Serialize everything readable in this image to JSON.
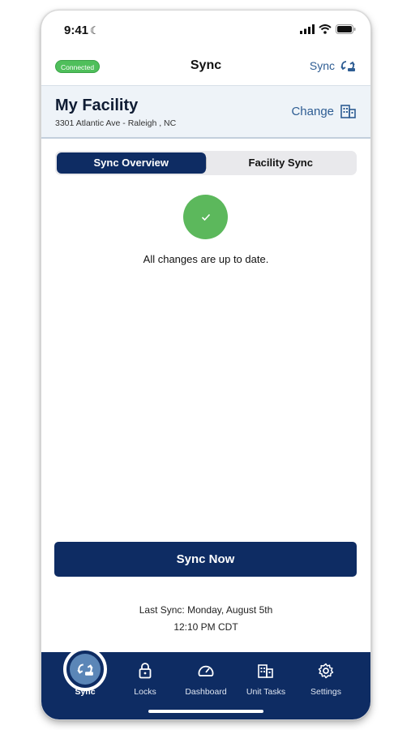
{
  "status_bar": {
    "time": "9:41"
  },
  "header": {
    "connection_badge": "Connected",
    "title": "Sync",
    "sync_label": "Sync"
  },
  "facility": {
    "name": "My Facility",
    "address": "3301 Atlantic Ave - Raleigh , NC",
    "change_label": "Change"
  },
  "segments": [
    {
      "label": "Sync Overview",
      "active": true
    },
    {
      "label": "Facility Sync",
      "active": false
    }
  ],
  "status": {
    "message": "All changes are up to date."
  },
  "sync_button": {
    "label": "Sync Now"
  },
  "last_sync": {
    "line1": "Last Sync: Monday, August 5th",
    "line2": "12:10 PM CDT"
  },
  "tabs": [
    {
      "label": "Sync",
      "icon": "sync-icon",
      "active": true
    },
    {
      "label": "Locks",
      "icon": "lock-icon",
      "active": false
    },
    {
      "label": "Dashboard",
      "icon": "gauge-icon",
      "active": false
    },
    {
      "label": "Unit Tasks",
      "icon": "building-icon",
      "active": false
    },
    {
      "label": "Settings",
      "icon": "gear-icon",
      "active": false
    }
  ],
  "colors": {
    "primary": "#0e2c63",
    "accent": "#2e5d93",
    "success": "#5cb85c",
    "facility_bg": "#eef3f8"
  }
}
